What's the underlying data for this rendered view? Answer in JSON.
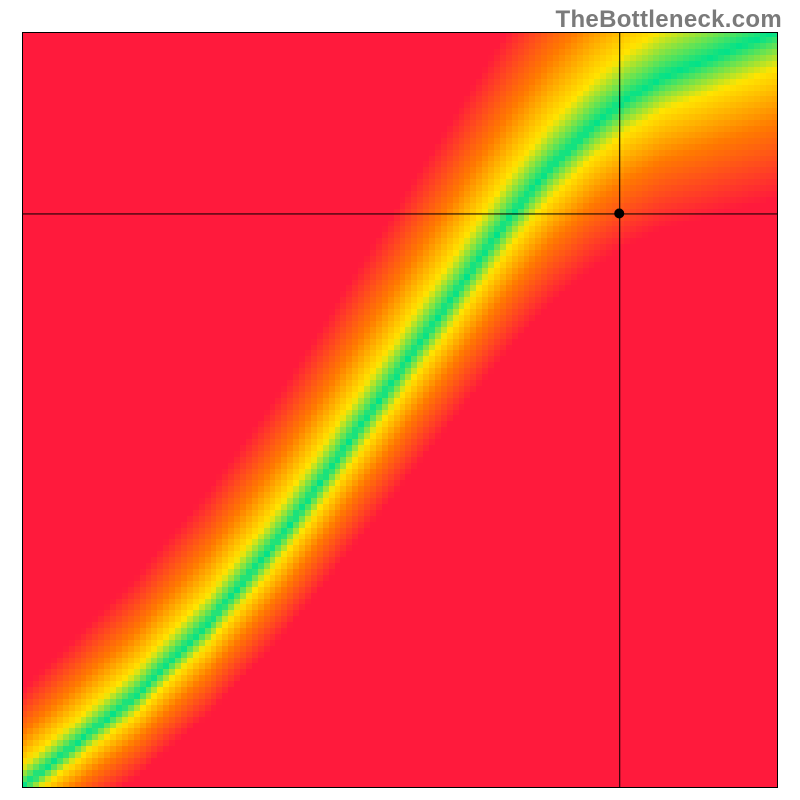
{
  "attribution": "TheBottleneck.com",
  "chart_data": {
    "type": "heatmap",
    "title": "",
    "xlabel": "",
    "ylabel": "",
    "xlim": [
      0,
      100
    ],
    "ylim": [
      0,
      100
    ],
    "grid": false,
    "legend": false,
    "crosshair": {
      "x": 79,
      "y": 76
    },
    "optimal_ridge": {
      "description": "Green optimal band running diagonally; value below is ridge y as function of x (percent)",
      "x": [
        0,
        5,
        10,
        15,
        20,
        25,
        30,
        35,
        40,
        45,
        50,
        55,
        60,
        65,
        70,
        75,
        80,
        85,
        90,
        95,
        100
      ],
      "y": [
        0,
        4,
        8,
        12,
        17,
        22,
        28,
        34,
        41,
        48,
        55,
        62,
        69,
        76,
        82,
        87,
        91,
        94,
        96,
        98,
        100
      ]
    },
    "color_stops": {
      "worst": "#ff1a3c",
      "bad": "#ff7a00",
      "mid": "#ffe400",
      "good": "#00e28a"
    },
    "pixelation": 128
  }
}
